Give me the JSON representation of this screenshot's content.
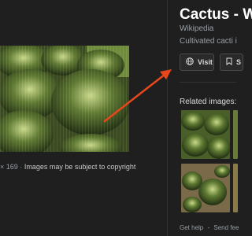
{
  "image_caption": {
    "dims": "× 169",
    "sep": "·",
    "warning": "Images may be subject to copyright"
  },
  "panel": {
    "title": "Cactus - W",
    "source": "Wikipedia",
    "description": "Cultivated cacti i",
    "visit_label": "Visit",
    "save_label": "S"
  },
  "related": {
    "heading": "Related images:"
  },
  "footer": {
    "help": "Get help",
    "sep": "-",
    "feedback": "Send fee"
  },
  "colors": {
    "background": "#1f1f1f",
    "annotation_arrow": "#e8471c"
  }
}
